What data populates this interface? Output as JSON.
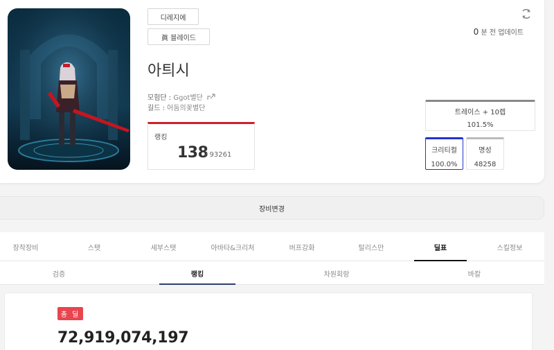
{
  "character": {
    "server": "디레지에",
    "job": "眞 블레이드",
    "name": "아틔시",
    "adventure_label": "모험단 : ",
    "adventure": "Ggot별단",
    "guild_label": "길드 : ",
    "guild": "어둠의꽃별단"
  },
  "ranking": {
    "label": "랭킹",
    "value": "138",
    "total": "/ 93261"
  },
  "update": {
    "count": "0",
    "text": "분 전 업데이트"
  },
  "stats": {
    "trace": {
      "title": "트레이스 + 10렙",
      "value": "101.5%"
    },
    "critical": {
      "title": "크리티컬",
      "value": "100.0%"
    },
    "fame": {
      "title": "명성",
      "value": "48258"
    }
  },
  "equip_change_label": "장비변경",
  "tabs": [
    {
      "label": "장착장비"
    },
    {
      "label": "스탯"
    },
    {
      "label": "세부스탯"
    },
    {
      "label": "아바타&크리처"
    },
    {
      "label": "버프강화"
    },
    {
      "label": "탈리스만"
    },
    {
      "label": "딜표"
    },
    {
      "label": "스킬정보"
    }
  ],
  "active_tab": "딜표",
  "subtabs": [
    {
      "label": "검증"
    },
    {
      "label": "랭킹"
    },
    {
      "label": "차원회랑"
    },
    {
      "label": "바칼"
    }
  ],
  "active_subtab": "랭킹",
  "deal": {
    "badge": "총 딜",
    "value": "72,919,074,197"
  },
  "colors": {
    "rank_accent": "#d0202a",
    "critical_border": "#2233cc",
    "deal_badge": "#e8454f",
    "subtab_underline": "#2c3e6b"
  },
  "icons": {
    "refresh": "refresh-icon",
    "share": "share-icon"
  }
}
